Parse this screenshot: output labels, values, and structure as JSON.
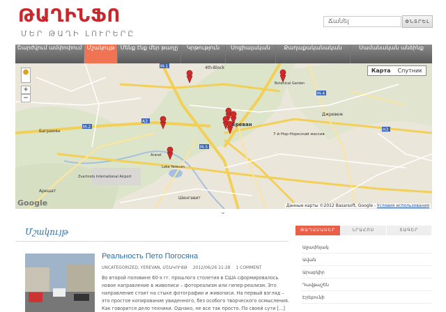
{
  "logo": {
    "title": "ԹԱՂԻՆՖՈ",
    "subtitle": "ՄԵՐ ԹԱՂԻ ԼՈՒՐԵՐԸ"
  },
  "search": {
    "placeholder": "Ճանել",
    "button": "ՓՆՏՐԵԼ"
  },
  "nav": {
    "items": [
      {
        "label": "Շարժվում ամփոփում",
        "active": false
      },
      {
        "label": "Մշակույթ",
        "active": true
      },
      {
        "label": "Մենք էնք մեր թաղը",
        "active": false
      },
      {
        "label": "Կրթություն",
        "active": false
      },
      {
        "label": "Սոցիալական",
        "active": false
      },
      {
        "label": "Քաղաքականական",
        "active": false
      },
      {
        "label": "Սամանական անձինք",
        "active": false
      }
    ]
  },
  "map": {
    "type_map": "Карта",
    "type_satellite": "Спутник",
    "google": "Google",
    "copyright": "Данные карты ©2012 Basarsoft, Google - ",
    "terms": "Условия использования",
    "labels": {
      "m1": "M-1",
      "m4": "M-4",
      "m2": "M-2",
      "m5": "M-5",
      "h3": "H3",
      "a3": "A3",
      "block": "4th-Block",
      "botanic": "Botanical Garden",
      "bagramyan": "Баграмян",
      "ararat": "Ararat",
      "lake": "Lake Yerevan",
      "airport": "Zvartnots International Airport",
      "aresh": "Арешат",
      "nork": "7-й Нор-Норкский массив",
      "dzhrvezh": "Джревеж",
      "shengavit": "Шенгавит",
      "yerevan": "Ереван"
    },
    "marker_color": "#d12a2a"
  },
  "main": {
    "section_title": "Մշակույթ",
    "post": {
      "title": "Реальность Пето Погосяна",
      "meta_cats": "UNCATEGORIZED, YEREVAN, ՄՇԱԿՈՒՅԹ",
      "meta_date": "2012/06/26 21:28",
      "meta_comments": "1 COMMENT",
      "body": "Во второй половине 60-х гг. прошлого столетия в США сформировалось новое направление в живописи – фотореализм или гипер-реализм. Это направление стоит на стыке фотографии и живописи. На первый взгляд – это простое копирование увиденного, без особого творческого осмысления. Как говорится дело техники. Однако, не все так просто. По своей сути [...]"
    }
  },
  "sidebar": {
    "tabs": [
      {
        "label": "ԹԱՂԱՄԱՍԵՐ",
        "active": true
      },
      {
        "label": "ԼՐԱՀՈՍ",
        "active": false
      },
      {
        "label": "ՏԱԳԵՐ",
        "active": false
      }
    ],
    "items": [
      "Աջափնյակ",
      "Ավան",
      "Արաբկիր",
      "Դավթաշեն",
      "Էրեբունի"
    ]
  },
  "colors": {
    "accent": "#f07353",
    "link": "#2a6ea6",
    "logo": "#c8282c"
  }
}
